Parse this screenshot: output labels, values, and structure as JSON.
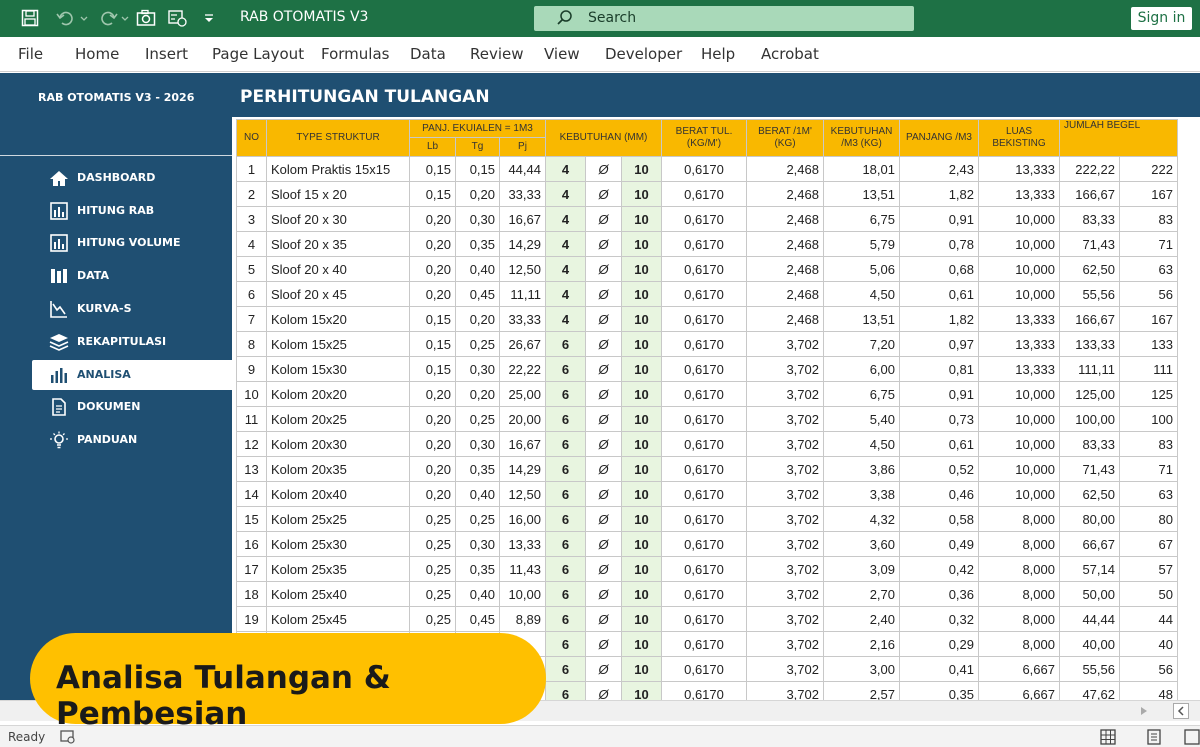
{
  "window": {
    "title": "RAB OTOMATIS V3",
    "search_label": "Search",
    "signin_label": "Sign in"
  },
  "ribbon": {
    "tabs": [
      "File",
      "Home",
      "Insert",
      "Page Layout",
      "Formulas",
      "Data",
      "Review",
      "View",
      "Developer",
      "Help",
      "Acrobat"
    ]
  },
  "sidebar": {
    "title": "RAB OTOMATIS V3 - 2026",
    "items": [
      {
        "label": "DASHBOARD",
        "icon": "home-icon"
      },
      {
        "label": "HITUNG RAB",
        "icon": "calculator-icon"
      },
      {
        "label": "HITUNG VOLUME",
        "icon": "calculator-icon"
      },
      {
        "label": "DATA",
        "icon": "book-icon"
      },
      {
        "label": "KURVA-S",
        "icon": "chart-line-icon"
      },
      {
        "label": "REKAPITULASI",
        "icon": "stack-icon"
      },
      {
        "label": "ANALISA",
        "icon": "bar-chart-icon"
      },
      {
        "label": "DOKUMEN",
        "icon": "document-icon"
      },
      {
        "label": "PANDUAN",
        "icon": "bulb-icon"
      }
    ],
    "active_index": 6
  },
  "main": {
    "title": "PERHITUNGAN TULANGAN"
  },
  "table": {
    "headers": {
      "no": "NO",
      "type": "TYPE STRUKTUR",
      "panj": "PANJ. EKUIALEN = 1M3",
      "lb": "Lb",
      "tg": "Tg",
      "pj": "Pj",
      "kebutuhan": "KEBUTUHAN (MM)",
      "berat_tul": "BERAT TUL. (KG/M')",
      "berat_1m": "BERAT /1M' (KG)",
      "kebutuhan_m3": "KEBUTUHAN /M3 (KG)",
      "panjang_m3": "PANJANG /M3",
      "luas": "LUAS BEKISTING",
      "jumlah": "JUMLAH BEGEL"
    },
    "rows": [
      [
        "1",
        "Kolom Praktis 15x15",
        "0,15",
        "0,15",
        "44,44",
        "4",
        "Ø",
        "10",
        "0,6170",
        "2,468",
        "18,01",
        "2,43",
        "13,333",
        "222,22",
        "222"
      ],
      [
        "2",
        "Sloof  15 x 20",
        "0,15",
        "0,20",
        "33,33",
        "4",
        "Ø",
        "10",
        "0,6170",
        "2,468",
        "13,51",
        "1,82",
        "13,333",
        "166,67",
        "167"
      ],
      [
        "3",
        "Sloof  20 x 30",
        "0,20",
        "0,30",
        "16,67",
        "4",
        "Ø",
        "10",
        "0,6170",
        "2,468",
        "6,75",
        "0,91",
        "10,000",
        "83,33",
        "83"
      ],
      [
        "4",
        "Sloof  20 x 35",
        "0,20",
        "0,35",
        "14,29",
        "4",
        "Ø",
        "10",
        "0,6170",
        "2,468",
        "5,79",
        "0,78",
        "10,000",
        "71,43",
        "71"
      ],
      [
        "5",
        "Sloof  20 x 40",
        "0,20",
        "0,40",
        "12,50",
        "4",
        "Ø",
        "10",
        "0,6170",
        "2,468",
        "5,06",
        "0,68",
        "10,000",
        "62,50",
        "63"
      ],
      [
        "6",
        "Sloof  20 x 45",
        "0,20",
        "0,45",
        "11,11",
        "4",
        "Ø",
        "10",
        "0,6170",
        "2,468",
        "4,50",
        "0,61",
        "10,000",
        "55,56",
        "56"
      ],
      [
        "7",
        "Kolom 15x20",
        "0,15",
        "0,20",
        "33,33",
        "4",
        "Ø",
        "10",
        "0,6170",
        "2,468",
        "13,51",
        "1,82",
        "13,333",
        "166,67",
        "167"
      ],
      [
        "8",
        "Kolom 15x25",
        "0,15",
        "0,25",
        "26,67",
        "6",
        "Ø",
        "10",
        "0,6170",
        "3,702",
        "7,20",
        "0,97",
        "13,333",
        "133,33",
        "133"
      ],
      [
        "9",
        "Kolom 15x30",
        "0,15",
        "0,30",
        "22,22",
        "6",
        "Ø",
        "10",
        "0,6170",
        "3,702",
        "6,00",
        "0,81",
        "13,333",
        "111,11",
        "111"
      ],
      [
        "10",
        "Kolom 20x20",
        "0,20",
        "0,20",
        "25,00",
        "6",
        "Ø",
        "10",
        "0,6170",
        "3,702",
        "6,75",
        "0,91",
        "10,000",
        "125,00",
        "125"
      ],
      [
        "11",
        "Kolom 20x25",
        "0,20",
        "0,25",
        "20,00",
        "6",
        "Ø",
        "10",
        "0,6170",
        "3,702",
        "5,40",
        "0,73",
        "10,000",
        "100,00",
        "100"
      ],
      [
        "12",
        "Kolom 20x30",
        "0,20",
        "0,30",
        "16,67",
        "6",
        "Ø",
        "10",
        "0,6170",
        "3,702",
        "4,50",
        "0,61",
        "10,000",
        "83,33",
        "83"
      ],
      [
        "13",
        "Kolom 20x35",
        "0,20",
        "0,35",
        "14,29",
        "6",
        "Ø",
        "10",
        "0,6170",
        "3,702",
        "3,86",
        "0,52",
        "10,000",
        "71,43",
        "71"
      ],
      [
        "14",
        "Kolom 20x40",
        "0,20",
        "0,40",
        "12,50",
        "6",
        "Ø",
        "10",
        "0,6170",
        "3,702",
        "3,38",
        "0,46",
        "10,000",
        "62,50",
        "63"
      ],
      [
        "15",
        "Kolom 25x25",
        "0,25",
        "0,25",
        "16,00",
        "6",
        "Ø",
        "10",
        "0,6170",
        "3,702",
        "4,32",
        "0,58",
        "8,000",
        "80,00",
        "80"
      ],
      [
        "16",
        "Kolom 25x30",
        "0,25",
        "0,30",
        "13,33",
        "6",
        "Ø",
        "10",
        "0,6170",
        "3,702",
        "3,60",
        "0,49",
        "8,000",
        "66,67",
        "67"
      ],
      [
        "17",
        "Kolom 25x35",
        "0,25",
        "0,35",
        "11,43",
        "6",
        "Ø",
        "10",
        "0,6170",
        "3,702",
        "3,09",
        "0,42",
        "8,000",
        "57,14",
        "57"
      ],
      [
        "18",
        "Kolom 25x40",
        "0,25",
        "0,40",
        "10,00",
        "6",
        "Ø",
        "10",
        "0,6170",
        "3,702",
        "2,70",
        "0,36",
        "8,000",
        "50,00",
        "50"
      ],
      [
        "19",
        "Kolom 25x45",
        "0,25",
        "0,45",
        "8,89",
        "6",
        "Ø",
        "10",
        "0,6170",
        "3,702",
        "2,40",
        "0,32",
        "8,000",
        "44,44",
        "44"
      ],
      [
        "",
        "",
        "",
        "",
        "",
        "6",
        "Ø",
        "10",
        "0,6170",
        "3,702",
        "2,16",
        "0,29",
        "8,000",
        "40,00",
        "40"
      ],
      [
        "",
        "",
        "",
        "",
        "",
        "6",
        "Ø",
        "10",
        "0,6170",
        "3,702",
        "3,00",
        "0,41",
        "6,667",
        "55,56",
        "56"
      ],
      [
        "",
        "",
        "",
        "",
        "",
        "6",
        "Ø",
        "10",
        "0,6170",
        "3,702",
        "2,57",
        "0,35",
        "6,667",
        "47,62",
        "48"
      ]
    ]
  },
  "overlay": {
    "text": "Analisa Tulangan & Pembesian"
  },
  "status": {
    "ready": "Ready"
  },
  "colors": {
    "excel_green": "#1e7145",
    "navy": "#1f4f72",
    "header_gold": "#f9b800",
    "badge": "#ffc000"
  }
}
